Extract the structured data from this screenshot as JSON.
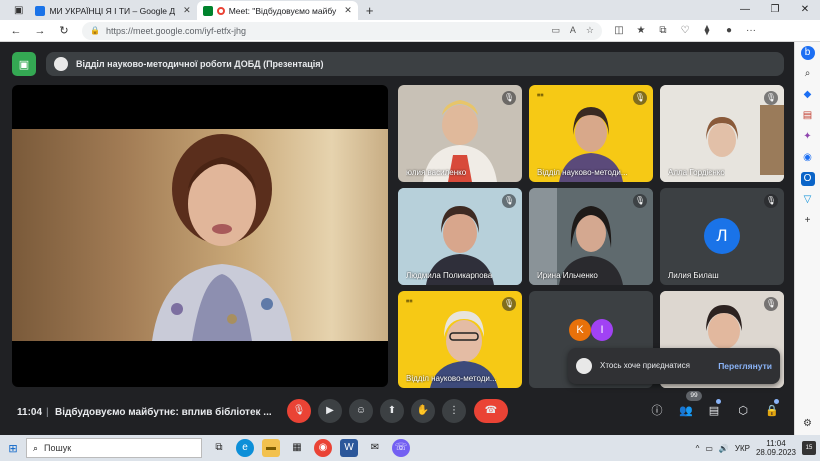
{
  "browser": {
    "tabs": [
      {
        "title": "МИ УКРАЇНЦІ Я І ТИ – Google Д",
        "favicon_color": "#1a73e8",
        "active": false
      },
      {
        "title": "Meet: \"Відбудовуємо майбу",
        "favicon_color": "#00832d",
        "active": true
      }
    ],
    "url": "https://meet.google.com/iyf-etfx-jhg"
  },
  "meet": {
    "meeting_header": "Відділ науково-методичної роботи ДОБД (Презентація)",
    "clock": "11:04",
    "separator": "|",
    "meeting_title": "Відбудовуємо майбутнє: вплив бібліотек ...",
    "participants_count": "99",
    "tiles": [
      {
        "name": "юлия василенко"
      },
      {
        "name": "Відділ науково-методи..."
      },
      {
        "name": "Алла Гордієнко"
      },
      {
        "name": "Людмила Поликарпова"
      },
      {
        "name": "Ирина Ильченко"
      },
      {
        "name": "Лилия Билаш",
        "initial": "Л"
      },
      {
        "name": "Відділ науково-методи..."
      },
      {
        "initials": [
          "K",
          "I"
        ]
      },
      {
        "name": ""
      }
    ],
    "toast": {
      "message": "Хтось хоче приєднатися",
      "action": "Переглянути"
    },
    "colors": {
      "hangup": "#ea4335",
      "yellow_tile": "#f6c915",
      "avatar_blue": "#1a73e8",
      "avatar_orange": "#e8710a",
      "avatar_purple": "#a142f4"
    }
  },
  "taskbar": {
    "search_placeholder": "Пошук",
    "language": "УКР",
    "time": "11:04",
    "date": "28.09.2023",
    "notifications": "15"
  }
}
